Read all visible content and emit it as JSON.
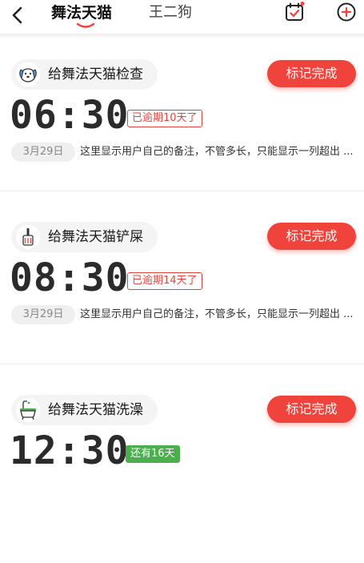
{
  "header": {
    "tabs": [
      {
        "label": "舞法天猫",
        "active": true
      },
      {
        "label": "王二狗",
        "active": false
      }
    ],
    "accent_color": "#f0433b"
  },
  "tasks": [
    {
      "title": "给舞法天猫检查",
      "icon": "dog-face-icon",
      "button_label": "标记完成",
      "time": "06:30",
      "status": "已逾期10天了",
      "status_type": "overdue",
      "date": "3月29日",
      "note": "这里显示用户自己的备注，不管多长，只能显示一列超出 ..."
    },
    {
      "title": "给舞法天猫铲屎",
      "icon": "litter-scoop-icon",
      "button_label": "标记完成",
      "time": "08:30",
      "status": "已逾期14天了",
      "status_type": "overdue",
      "date": "3月29日",
      "note": "这里显示用户自己的备注，不管多长，只能显示一列超出 ..."
    },
    {
      "title": "给舞法天猫洗澡",
      "icon": "bathtub-icon",
      "button_label": "标记完成",
      "time": "12:30",
      "status": "还有16天",
      "status_type": "upcoming",
      "date": "",
      "note": ""
    }
  ]
}
